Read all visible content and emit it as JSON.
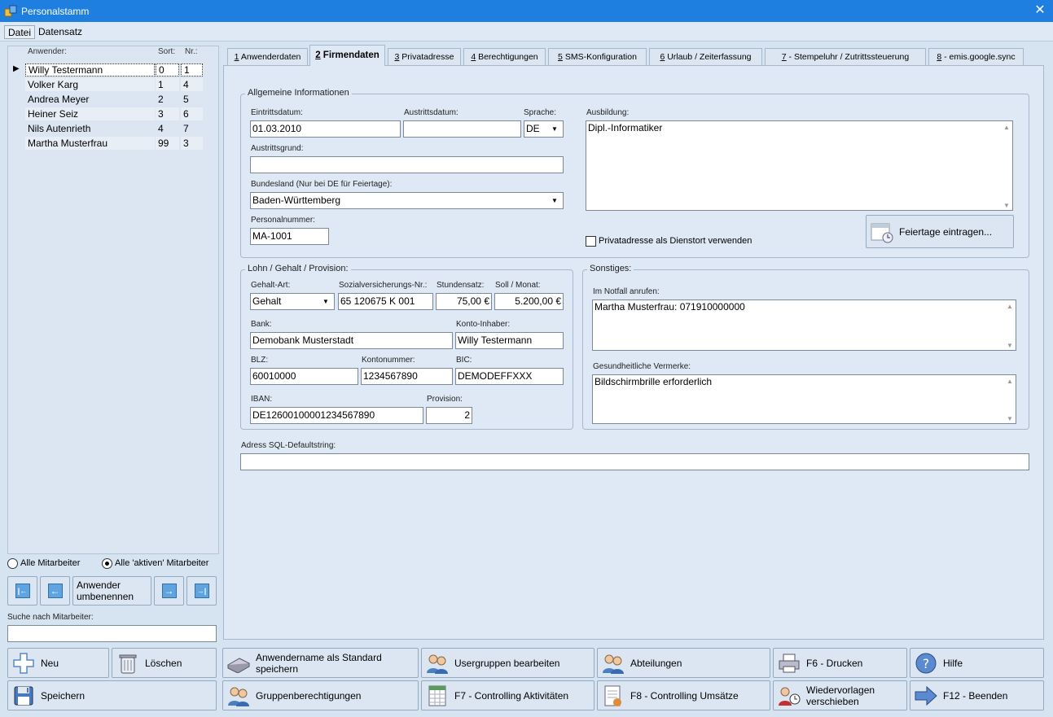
{
  "window": {
    "title": "Personalstamm",
    "close": "✕"
  },
  "menu": [
    "Datei",
    "Datensatz"
  ],
  "userlist": {
    "headers": [
      "Anwender:",
      "Sort:",
      "Nr.:"
    ],
    "rows": [
      [
        "Willy Testermann",
        "0",
        "1"
      ],
      [
        "Volker Karg",
        "1",
        "4"
      ],
      [
        "Andrea Meyer",
        "2",
        "5"
      ],
      [
        "Heiner Seiz",
        "3",
        "6"
      ],
      [
        "Nils Autenrieth",
        "4",
        "7"
      ],
      [
        "Martha Musterfrau",
        "99",
        "3"
      ]
    ],
    "selected_marker": "▶"
  },
  "filter": {
    "all": "Alle Mitarbeiter",
    "active": "Alle 'aktiven' Mitarbeiter",
    "selected": "active"
  },
  "nav": {
    "first": "|←",
    "prev": "←",
    "rename": "Anwender umbenennen",
    "next": "→",
    "last": "→|"
  },
  "search": {
    "label": "Suche nach Mitarbeiter:",
    "value": ""
  },
  "tabs": [
    {
      "num": "1",
      "label": "Anwenderdaten"
    },
    {
      "num": "2",
      "label": "Firmendaten"
    },
    {
      "num": "3",
      "label": "Privatadresse"
    },
    {
      "num": "4",
      "label": "Berechtigungen"
    },
    {
      "num": "5",
      "label": "SMS-Konfiguration"
    },
    {
      "num": "6",
      "label": "Urlaub / Zeiterfassung"
    },
    {
      "num": "7",
      "label": "- Stempeluhr / Zutrittssteuerung"
    },
    {
      "num": "8",
      "label": "- emis.google.sync"
    }
  ],
  "active_tab": 1,
  "general": {
    "title": "Allgemeine Informationen",
    "eintritt_label": "Eintrittsdatum:",
    "eintritt": "01.03.2010",
    "austritt_label": "Austrittsdatum:",
    "austritt": "",
    "sprache_label": "Sprache:",
    "sprache": "DE",
    "austrittsgrund_label": "Austrittsgrund:",
    "austrittsgrund": "",
    "bundesland_label": "Bundesland (Nur bei DE für Feiertage):",
    "bundesland": "Baden-Württemberg",
    "personalnr_label": "Personalnummer:",
    "personalnr": "MA-1001",
    "ausbildung_label": "Ausbildung:",
    "ausbildung": "Dipl.-Informatiker",
    "privat_check": "Privatadresse als Dienstort verwenden",
    "feiertage_btn": "Feiertage eintragen..."
  },
  "lohn": {
    "title": "Lohn / Gehalt / Provision:",
    "art_label": "Gehalt-Art:",
    "art": "Gehalt",
    "svnr_label": "Sozialversicherungs-Nr.:",
    "svnr": "65 120675 K 001",
    "stundensatz_label": "Stundensatz:",
    "stundensatz": "75,00 €",
    "soll_label": "Soll / Monat:",
    "soll": "5.200,00 €",
    "bank_label": "Bank:",
    "bank": "Demobank Musterstadt",
    "inhaber_label": "Konto-Inhaber:",
    "inhaber": "Willy Testermann",
    "blz_label": "BLZ:",
    "blz": "60010000",
    "konto_label": "Kontonummer:",
    "konto": "1234567890",
    "bic_label": "BIC:",
    "bic": "DEMODEFFXXX",
    "iban_label": "IBAN:",
    "iban": "DE12600100001234567890",
    "provision_label": "Provision:",
    "provision": "2"
  },
  "sonstiges": {
    "title": "Sonstiges:",
    "notfall_label": "Im Notfall anrufen:",
    "notfall": "Martha Musterfrau: 071910000000",
    "gesund_label": "Gesundheitliche Vermerke:",
    "gesund": "Bildschirmbrille erforderlich"
  },
  "sql": {
    "label": "Adress SQL-Defaultstring:",
    "value": ""
  },
  "buttons": {
    "neu": "Neu",
    "loeschen": "Löschen",
    "std": "Anwendername als Standard speichern",
    "usergruppen": "Usergruppen bearbeiten",
    "abteilungen": "Abteilungen",
    "drucken": "F6 - Drucken",
    "hilfe": "Hilfe",
    "speichern": "Speichern",
    "gruppenber": "Gruppenberechtigungen",
    "f7": "F7 - Controlling Aktivitäten",
    "f8": "F8 - Controlling Umsätze",
    "wiedervorlagen": "Wiedervorlagen verschieben",
    "f12": "F12 - Beenden"
  },
  "colors": {
    "titlebar": "#1f7fe0",
    "panel": "#dfe9f5",
    "accent_blue": "#5fa3e0"
  }
}
